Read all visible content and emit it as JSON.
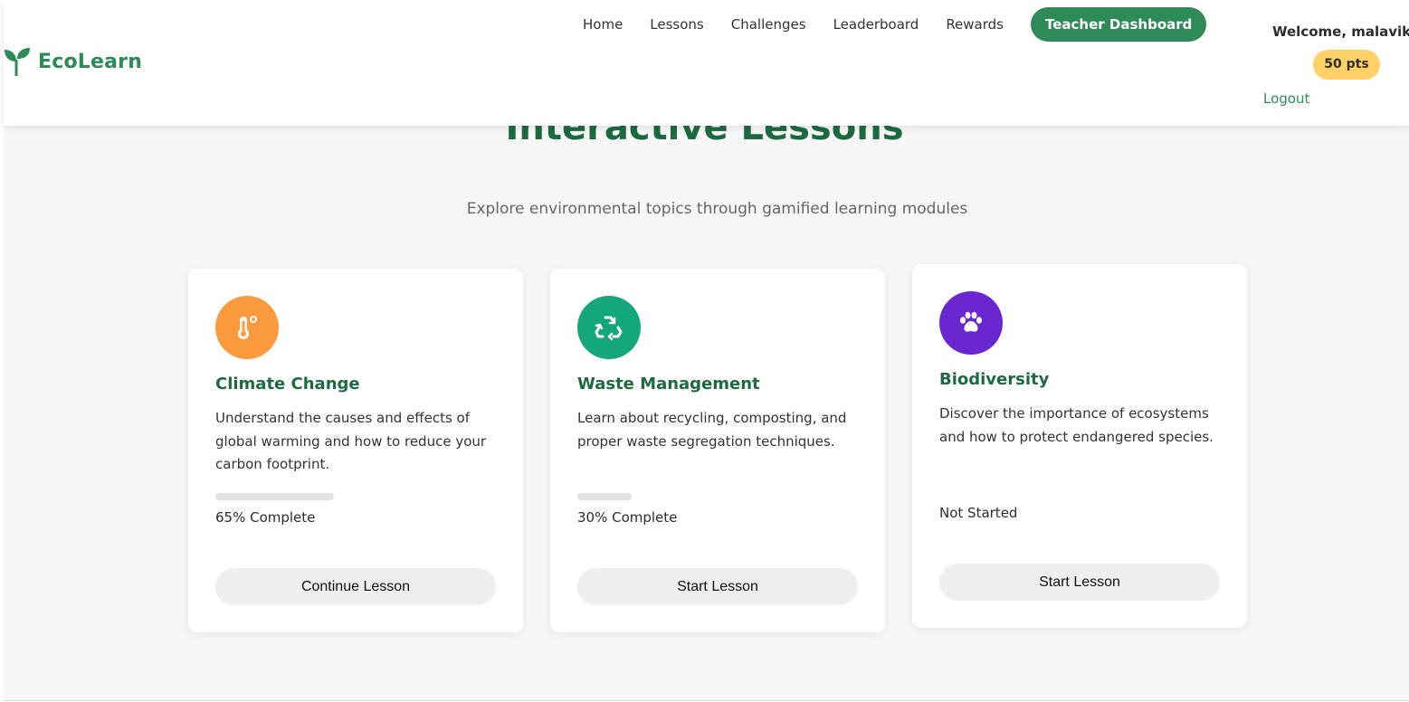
{
  "brand": {
    "name": "EcoLearn",
    "icon": "sprout-icon"
  },
  "nav": {
    "links": [
      "Home",
      "Lessons",
      "Challenges",
      "Leaderboard",
      "Rewards"
    ],
    "cta": "Teacher Dashboard"
  },
  "user": {
    "welcome": "Welcome, malavik",
    "points": "50 pts",
    "logout": "Logout"
  },
  "main": {
    "title": "Interactive Lessons",
    "subtitle": "Explore environmental topics through gamified learning modules"
  },
  "lessons": [
    {
      "icon": "thermometer-icon",
      "color": "#fd9a3e",
      "title": "Climate Change",
      "description": "Understand the causes and effects of global warming and how to reduce your carbon footprint.",
      "progress": 0.65,
      "status": "65% Complete",
      "button": "Continue Lesson"
    },
    {
      "icon": "recycle-icon",
      "color": "#14a77b",
      "title": "Waste Management",
      "description": "Learn about recycling, composting, and proper waste segregation techniques.",
      "progress": 0.3,
      "status": "30% Complete",
      "button": "Start Lesson"
    },
    {
      "icon": "paw-icon",
      "color": "#6a26cf",
      "title": "Biodiversity",
      "description": "Discover the importance of ecosystems and how to protect endangered species.",
      "progress": 0,
      "status": "Not Started",
      "button": "Start Lesson"
    }
  ]
}
